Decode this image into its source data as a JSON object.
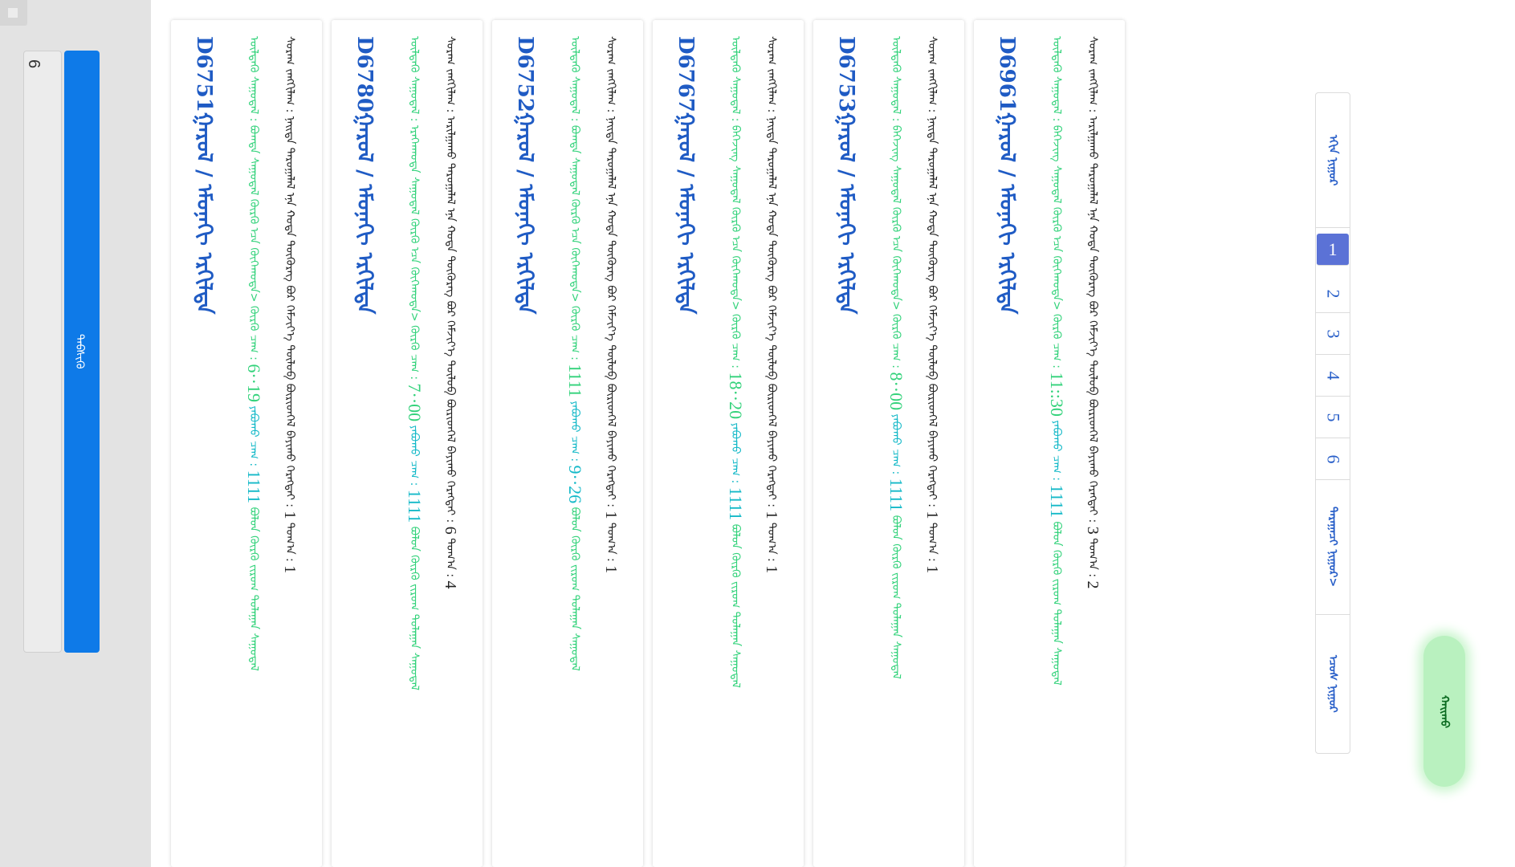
{
  "sidebar": {
    "page_input_value": "6",
    "go_label": "ᠳᠡᠪᠰᠢᠬᠦ"
  },
  "labels": {
    "title_suffix": "ᠭᠠᠷᠤᠯ / ᠡᠮᠦᠨᠡᠬᠢ ᠡᠷᠭᠢᠯᠳᠡ",
    "depart_prefix": "ᠦᠯᠳᠡᠭᠦ ᠰᠠᠭᠤᠳᠠᠯ :",
    "depart_mid": "ᠣᠳᠤᠬᠢ ᠰᠢᠯᠵᠢᠯᠲᠡ :",
    "arrive_label": "ᠬᠦᠷᠬᠦ ᠴᠠᠭ :",
    "travel_label": "ᠶᠠᠪᠤᠬᠤ ᠴᠠᠭ :",
    "info_prefix": "ᠰᠤᠷᠠᠭ ᠵᠠᠩᠭᠢᠯᠠᠭ :",
    "info_mid": "ᠪᠦᠷᠢᠳᠬᠡᠯ ᠪᠠᠶᠢᠬᠤ ᠬᠡᠷᠡᠭᠲᠡᠢ :",
    "count_label": "ᠲᠣᠭ᠎ᠠ :"
  },
  "trains": [
    {
      "code": "D6961",
      "depart_route": "ᠪᠡᠭᠡᠵᠢᠩ ᠰᠠᠭᠤᠳᠠᠯ ᠬᠦᠷᠬᠦ ᠡᠴᠡ ᠬᠥᠬᠡᠬᠣᠲᠠ>",
      "time": "11::30",
      "travel": "1111",
      "tail": "ᠪᠣᠯᠤᠨ ᠬᠦᠷᠬᠦ ᠵᠢᠷᠤᠭ ᠳᠤᠯᠠᠭᠠᠨ ᠰᠠᠭᠤᠳᠠᠯ",
      "info_text": "ᠠᠷᠢᠯᠭᠠᠬᠤ ᠳᠠᠷᠤᠭᠠᠯᠠᠯ ᠡᠨᠡ ᠬᠤᠲᠠ ᠳᠦᠭᠦᠷᠡᠭ ᠪᠤᠷ ᠬᠡᠮᠵᠢᠶ᠎ᠡ ᠲᠥᠯᠦᠪ",
      "count_a": "3",
      "count_b": "2"
    },
    {
      "code": "D6753",
      "depart_route": "ᠪᠡᠭᠡᠵᠢᠩ ᠰᠠᠭᠤᠳᠠᠯ ᠬᠦᠷᠬᠦ ᠡᠴᠡ ᠬᠥᠬᠡᠬᠣᠲᠠ>",
      "time": "8··00",
      "travel": "1111",
      "tail": "ᠪᠣᠯᠤᠨ ᠬᠦᠷᠬᠦ ᠵᠢᠷᠤᠭ ᠳᠤᠯᠠᠭᠠᠨ ᠰᠠᠭᠤᠳᠠᠯ",
      "info_text": "ᠨᠡᠢᠲᠡ ᠳᠠᠷᠤᠭᠠᠯᠠᠯ ᠡᠨᠡ ᠬᠤᠲᠠ ᠳᠦᠭᠦᠷᠡᠭ ᠪᠤᠷ ᠬᠡᠮᠵᠢᠶ᠎ᠡ ᠲᠥᠯᠦᠪ",
      "count_a": "1",
      "count_b": "1"
    },
    {
      "code": "D6767",
      "depart_route": "ᠪᠡᠭᠡᠵᠢᠩ ᠰᠠᠭᠤᠳᠠᠯ ᠬᠦᠷᠬᠦ ᠡᠴᠡ ᠬᠥᠬᠡᠬᠣᠲᠠ>",
      "time": "18··20",
      "travel": "1111",
      "tail": "ᠪᠣᠯᠤᠨ ᠬᠦᠷᠬᠦ ᠵᠢᠷᠤᠭ ᠳᠤᠯᠠᠭᠠᠨ ᠰᠠᠭᠤᠳᠠᠯ",
      "info_text": "ᠨᠡᠢᠲᠡ ᠳᠠᠷᠤᠭᠠᠯᠠᠯ ᠡᠨᠡ ᠬᠤᠲᠠ ᠳᠦᠭᠦᠷᠡᠭ ᠪᠤᠷ ᠬᠡᠮᠵᠢᠶ᠎ᠡ ᠲᠥᠯᠦᠪ",
      "count_a": "1",
      "count_b": "1"
    },
    {
      "code": "D6752",
      "depart_route": "ᠪᠣᠭᠳᠠ ᠰᠠᠭᠤᠳᠠᠯ ᠬᠦᠷᠬᠦ ᠡᠴᠡ ᠬᠥᠬᠡᠬᠣᠲᠠ>",
      "time": "1111",
      "travel": "9··26",
      "tail": "ᠪᠣᠯᠤᠨ ᠬᠦᠷᠬᠦ ᠵᠢᠷᠤᠭ ᠳᠤᠯᠠᠭᠠᠨ ᠰᠠᠭᠤᠳᠠᠯ",
      "info_text": "ᠨᠡᠢᠲᠡ ᠳᠠᠷᠤᠭᠠᠯᠠᠯ ᠡᠨᠡ ᠬᠤᠲᠠ ᠳᠦᠭᠦᠷᠡᠭ ᠪᠤᠷ ᠬᠡᠮᠵᠢᠶ᠎ᠡ ᠲᠥᠯᠦᠪ",
      "count_a": "1",
      "count_b": "1"
    },
    {
      "code": "D6780",
      "depart_route": "ᠡᠷᠡᠭᠡᠨᠬᠣᠲᠠ ᠰᠠᠭᠤᠳᠠᠯ ᠬᠦᠷᠬᠦ ᠡᠴᠡ ᠬᠥᠬᠡᠬᠣᠲᠠ>",
      "time": "7··00",
      "travel": "1111",
      "tail": "ᠪᠣᠯᠤᠨ ᠬᠦᠷᠬᠦ ᠵᠢᠷᠤᠭ ᠳᠤᠯᠠᠭᠠᠨ ᠰᠠᠭᠤᠳᠠᠯ",
      "info_text": "ᠠᠷᠢᠯᠭᠠᠬᠤ ᠳᠠᠷᠤᠭᠠᠯᠠᠯ ᠡᠨᠡ ᠬᠤᠲᠠ ᠳᠦᠭᠦᠷᠡᠭ ᠪᠤᠷ ᠬᠡᠮᠵᠢᠶ᠎ᠡ ᠲᠥᠯᠦᠪ",
      "count_a": "6",
      "count_b": "4"
    },
    {
      "code": "D6751",
      "depart_route": "ᠪᠣᠭᠳᠠ ᠰᠠᠭᠤᠳᠠᠯ ᠬᠦᠷᠬᠦ ᠡᠴᠡ ᠬᠥᠬᠡᠬᠣᠲᠠ>",
      "time": "6··19",
      "travel": "1111",
      "tail": "ᠪᠣᠯᠤᠨ ᠬᠦᠷᠬᠦ ᠵᠢᠷᠤᠭ ᠳᠤᠯᠠᠭᠠᠨ ᠰᠠᠭᠤᠳᠠᠯ",
      "info_text": "ᠨᠡᠢᠲᠡ ᠳᠠᠷᠤᠭᠠᠯᠠᠯ ᠡᠨᠡ ᠬᠤᠲᠠ ᠳᠦᠭᠦᠷᠡᠭ ᠪᠤᠷ ᠬᠡᠮᠵᠢᠶ᠎ᠡ ᠲᠥᠯᠦᠪ",
      "count_a": "1",
      "count_b": "1"
    }
  ],
  "pagination": {
    "first_label": "ᠡᠬᠢᠨ ᠨᠢᠭᠤᠷ",
    "pages": [
      "1",
      "2",
      "3",
      "4",
      "5",
      "6"
    ],
    "active_page": "1",
    "next_label": "ᠳᠠᠷᠠᠭᠠᠴᠢ ᠨᠢᠭᠤᠷ>",
    "last_label": "ᠡᠴᠦᠰ ᠨᠢᠭᠤᠷ"
  },
  "search": {
    "label": "ᠬᠠᠢᠬᠤ"
  },
  "colors": {
    "accent_blue": "#0e7ae8",
    "title_blue": "#1f5bc4",
    "time_green": "#32d27a",
    "travel_cyan": "#15b9c8",
    "active_page": "#5b72d6",
    "search_green": "#b9f1bf"
  }
}
